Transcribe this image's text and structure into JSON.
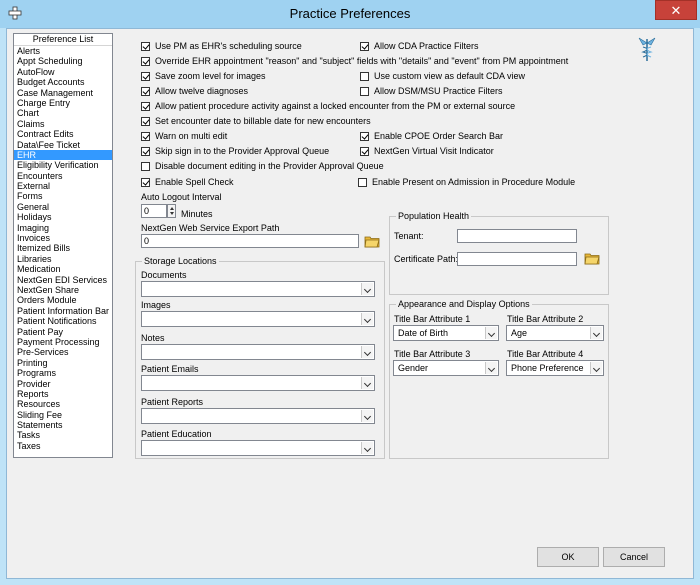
{
  "window": {
    "title": "Practice Preferences",
    "close_glyph": "✕",
    "accent_color": "#9fd2f1",
    "close_color": "#c7423a"
  },
  "preference_list": {
    "header": "Preference List",
    "selected": "EHR",
    "items": [
      "Alerts",
      "Appt Scheduling",
      "AutoFlow",
      "Budget Accounts",
      "Case Management",
      "Charge Entry",
      "Chart",
      "Claims",
      "Contract Edits",
      "Data\\Fee Ticket",
      "EHR",
      "Eligibility Verification",
      "Encounters",
      "External",
      "Forms",
      "General",
      "Holidays",
      "Imaging",
      "Invoices",
      "Itemized Bills",
      "Libraries",
      "Medication",
      "NextGen EDI Services",
      "NextGen Share",
      "Orders Module",
      "Patient Information Bar",
      "Patient Notifications",
      "Patient Pay",
      "Payment Processing",
      "Pre-Services",
      "Printing",
      "Programs",
      "Provider",
      "Reports",
      "Resources",
      "Sliding Fee",
      "Statements",
      "Tasks",
      "Taxes"
    ]
  },
  "options": {
    "use_pm_scheduling": {
      "label": "Use PM as EHR's scheduling source",
      "checked": true
    },
    "allow_cda_filters": {
      "label": "Allow CDA Practice Filters",
      "checked": true
    },
    "override_appointment": {
      "label": "Override EHR appointment \"reason\" and \"subject\" fields with \"details\" and \"event\" from PM appointment",
      "checked": true
    },
    "save_zoom": {
      "label": "Save zoom level for images",
      "checked": true
    },
    "custom_cda_view": {
      "label": "Use custom view as default CDA view",
      "checked": false
    },
    "twelve_diagnoses": {
      "label": "Allow twelve diagnoses",
      "checked": true
    },
    "dsm_filters": {
      "label": "Allow DSM/MSU Practice Filters",
      "checked": false
    },
    "locked_encounter": {
      "label": "Allow patient procedure activity against a locked encounter from the PM or external source",
      "checked": true
    },
    "billable_date": {
      "label": "Set encounter date to billable date for new encounters",
      "checked": true
    },
    "warn_multi_edit": {
      "label": "Warn on multi edit",
      "checked": true
    },
    "cpoe_search": {
      "label": "Enable CPOE Order Search Bar",
      "checked": true
    },
    "skip_sign_in": {
      "label": "Skip sign in to the Provider Approval Queue",
      "checked": true
    },
    "virtual_visit": {
      "label": "NextGen Virtual Visit Indicator",
      "checked": true
    },
    "disable_doc_edit": {
      "label": "Disable document editing in the Provider Approval Queue",
      "checked": false
    },
    "spell_check": {
      "label": "Enable Spell Check",
      "checked": true
    },
    "present_on_admission": {
      "label": "Enable Present on Admission in Procedure Module",
      "checked": false
    }
  },
  "auto_logout": {
    "label": "Auto Logout Interval",
    "value": "0",
    "unit": "Minutes"
  },
  "web_service": {
    "label": "NextGen Web Service Export Path",
    "value": "0"
  },
  "storage": {
    "title": "Storage Locations",
    "items": [
      {
        "label": "Documents",
        "value": ""
      },
      {
        "label": "Images",
        "value": ""
      },
      {
        "label": "Notes",
        "value": ""
      },
      {
        "label": "Patient Emails",
        "value": ""
      },
      {
        "label": "Patient Reports",
        "value": ""
      },
      {
        "label": "Patient Education",
        "value": ""
      }
    ]
  },
  "population_health": {
    "title": "Population Health",
    "tenant_label": "Tenant:",
    "tenant_value": "",
    "cert_label": "Certificate Path:",
    "cert_value": ""
  },
  "appearance": {
    "title": "Appearance and Display Options",
    "attrs": [
      {
        "label": "Title Bar Attribute 1",
        "value": "Date of Birth"
      },
      {
        "label": "Title Bar Attribute 2",
        "value": "Age"
      },
      {
        "label": "Title Bar Attribute 3",
        "value": "Gender"
      },
      {
        "label": "Title Bar Attribute 4",
        "value": "Phone Preference"
      }
    ]
  },
  "buttons": {
    "ok": "OK",
    "cancel": "Cancel"
  },
  "icons": {
    "app": "app-icon",
    "close": "close-icon",
    "folder": "folder-icon",
    "caduceus": "caduceus-icon"
  }
}
